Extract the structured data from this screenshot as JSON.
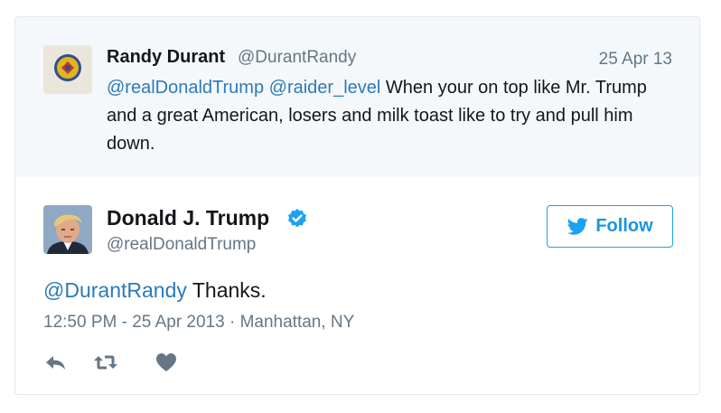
{
  "quoted_tweet": {
    "name": "Randy Durant",
    "handle": "@DurantRandy",
    "date": "25 Apr 13",
    "mention1": "@realDonaldTrump",
    "mention2": "@raider_level",
    "text": " When your on top like Mr. Trump and a great American, losers and milk toast like to try and pull him down."
  },
  "tweet": {
    "name": "Donald J. Trump",
    "handle": "@realDonaldTrump",
    "mention": "@DurantRandy",
    "text": " Thanks.",
    "timestamp": "12:50 PM - 25 Apr 2013 · Manhattan, NY"
  },
  "follow_button": {
    "label": "Follow"
  },
  "icons": {
    "verified": "verified-badge-icon",
    "follow": "twitter-bird-icon",
    "reply": "reply-icon",
    "retweet": "retweet-icon",
    "like": "heart-icon"
  },
  "colors": {
    "link": "#2b7bb9",
    "brand": "#1da1f2",
    "muted": "#657786",
    "reply_background": "#f5f8fa"
  }
}
